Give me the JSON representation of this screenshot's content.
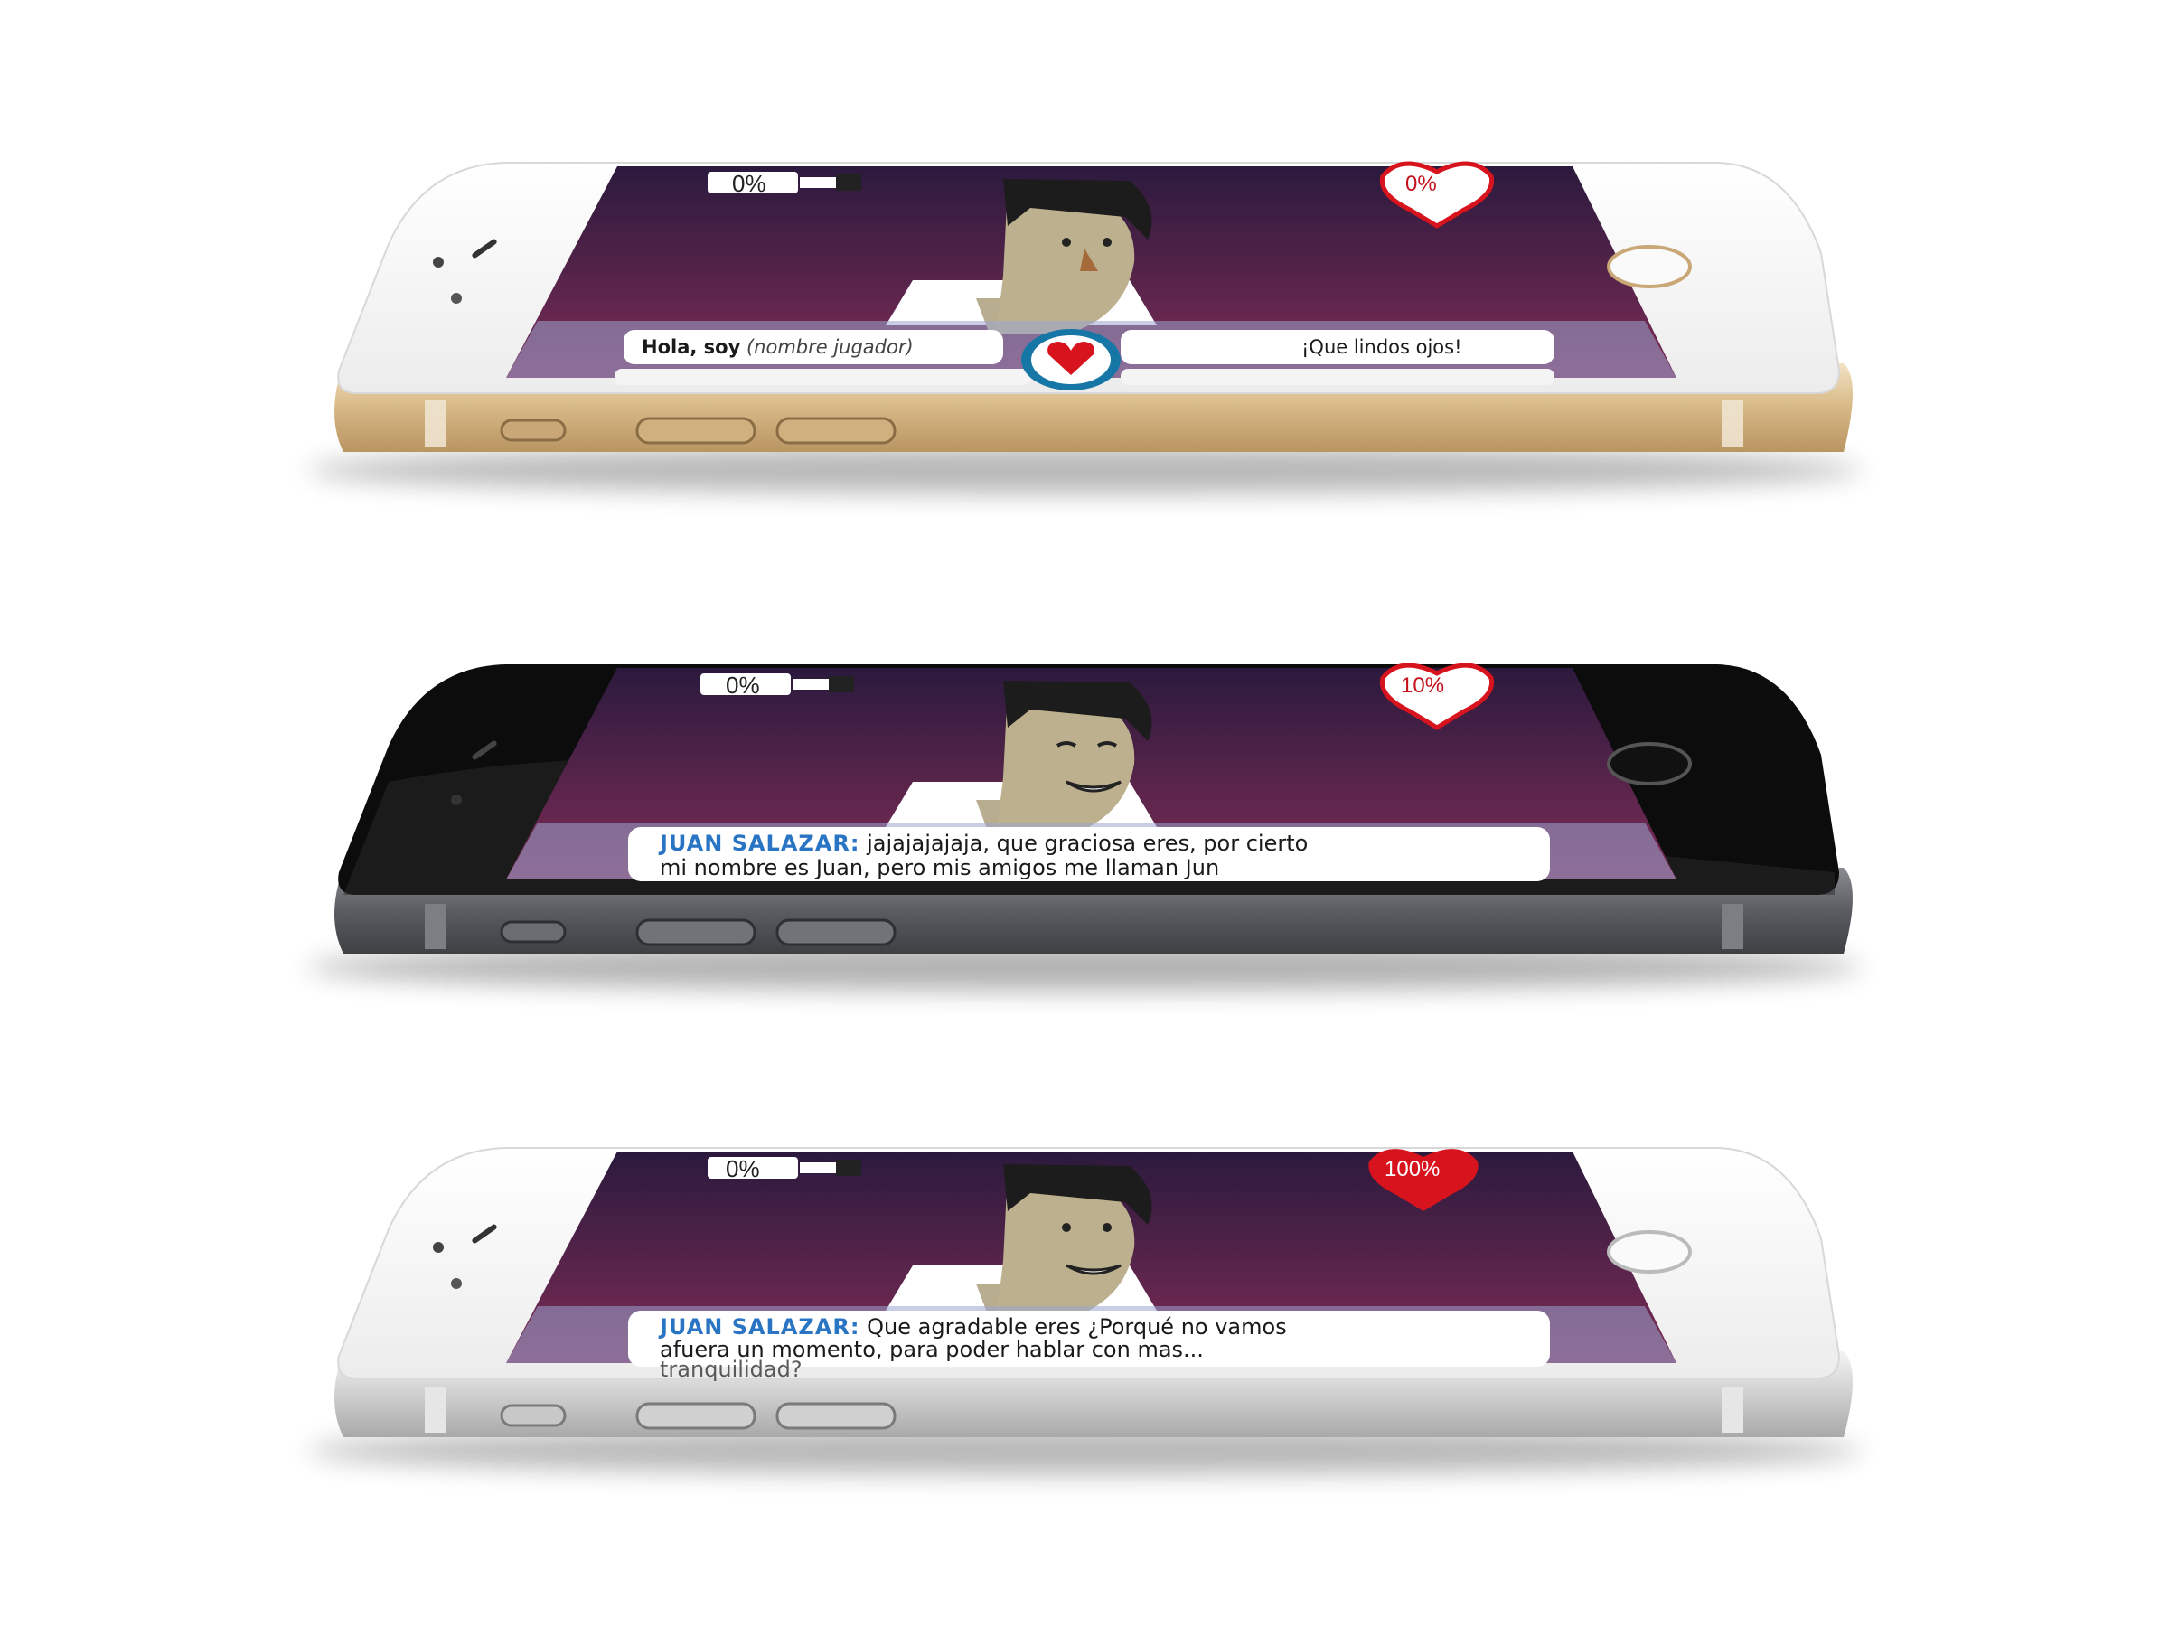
{
  "devices": [
    {
      "variant": "gold",
      "bottle_meter": "0%",
      "heart_meter": "0%",
      "options": {
        "left_strong": "Hola, soy",
        "left_placeholder": "(nombre jugador)",
        "right": "¡Que lindos ojos!"
      },
      "center_icon": "heart-icon"
    },
    {
      "variant": "space-gray",
      "bottle_meter": "0%",
      "heart_meter": "10%",
      "dialogue": {
        "speaker": "JUAN SALAZAR:",
        "line1": "jajajajajaja, que graciosa eres, por cierto",
        "line2": "mi nombre es Juan, pero mis amigos me llaman Jun"
      }
    },
    {
      "variant": "silver",
      "bottle_meter": "0%",
      "heart_meter": "100%",
      "dialogue": {
        "speaker": "JUAN SALAZAR:",
        "line1": "Que agradable eres ¿Porqué no vamos",
        "line2": "afuera un momento, para poder hablar con mas...",
        "line3": "tranquilidad?"
      }
    }
  ],
  "colors": {
    "gold_frame": "#d9bc92",
    "gray_frame": "#55575c",
    "silver_frame": "#d2d2d2",
    "screen_top": "#2d1a3e",
    "screen_bottom": "#7a2b55",
    "heart": "#d7141e",
    "speaker": "#2a74c4"
  }
}
